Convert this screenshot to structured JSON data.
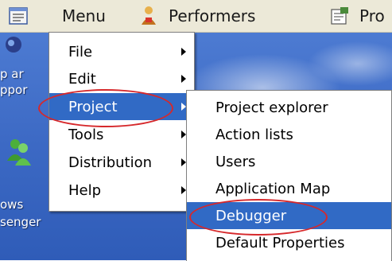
{
  "menubar": {
    "items": [
      {
        "label": "",
        "icon": "app-menu-icon"
      },
      {
        "label": "Menu"
      },
      {
        "label": "Performers",
        "icon": "performer-icon"
      },
      {
        "label": "Pro",
        "icon": "properties-icon"
      }
    ]
  },
  "desktop": {
    "labels": [
      "p ar",
      "ppor",
      "ows",
      "senger"
    ],
    "icons": [
      "shortcut-icon",
      "messenger-icon"
    ]
  },
  "menu": {
    "items": [
      {
        "label": "File",
        "has_submenu": true
      },
      {
        "label": "Edit",
        "has_submenu": true
      },
      {
        "label": "Project",
        "has_submenu": true,
        "selected": true,
        "annotated": true
      },
      {
        "label": "Tools",
        "has_submenu": true
      },
      {
        "label": "Distribution",
        "has_submenu": true
      },
      {
        "label": "Help",
        "has_submenu": true
      }
    ]
  },
  "submenu": {
    "items": [
      {
        "label": "Project explorer"
      },
      {
        "label": "Action lists"
      },
      {
        "label": "Users"
      },
      {
        "label": "Application Map"
      },
      {
        "label": "Debugger",
        "selected": true,
        "annotated": true
      },
      {
        "label": "Default Properties"
      }
    ]
  },
  "colors": {
    "highlight": "#316ac5",
    "annotation": "#d6282b",
    "menubar": "#ece9d8",
    "desktop": "#3c69c4"
  }
}
